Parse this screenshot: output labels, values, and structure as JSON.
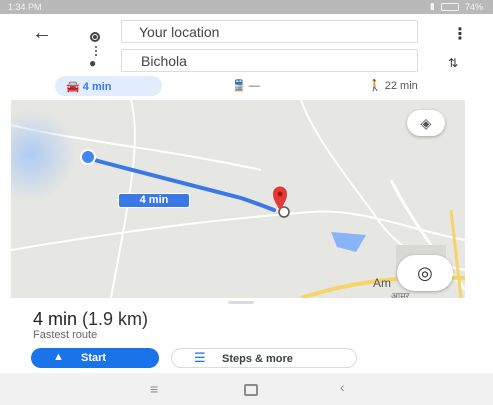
{
  "status_bar": {
    "time": "1:34 PM",
    "battery": "74%"
  },
  "header": {
    "origin": "Your location",
    "destination": "Bichola",
    "icons": {
      "back": "arrow-left-icon",
      "origin": "origin-dot-icon",
      "destination": "place-pin-icon",
      "more": "more-vert-icon",
      "swap": "swap-icon"
    }
  },
  "modes": [
    {
      "mode": "drive",
      "icon": "car-icon",
      "label": "4 min",
      "selected": true
    },
    {
      "mode": "transit",
      "icon": "train-icon",
      "label": "—",
      "selected": false
    },
    {
      "mode": "walk",
      "icon": "walk-icon",
      "label": "22 min",
      "selected": false
    }
  ],
  "map": {
    "route_label": "4 min",
    "place_label": "Am",
    "place_label_sub": "आमुर",
    "icons": {
      "layers": "layers-icon",
      "my_location": "my-location-icon",
      "route_start": "vehicle-icon",
      "destination": "red-pin-icon"
    }
  },
  "summary": {
    "duration": "4 min",
    "distance": "(1.9 km)",
    "description": "Fastest route",
    "start_label": "Start",
    "steps_label": "Steps & more"
  },
  "colors": {
    "accent": "#1a73e8",
    "route": "#3b78e7",
    "pin": "#e53935",
    "map_bg": "#e6e6e2"
  }
}
